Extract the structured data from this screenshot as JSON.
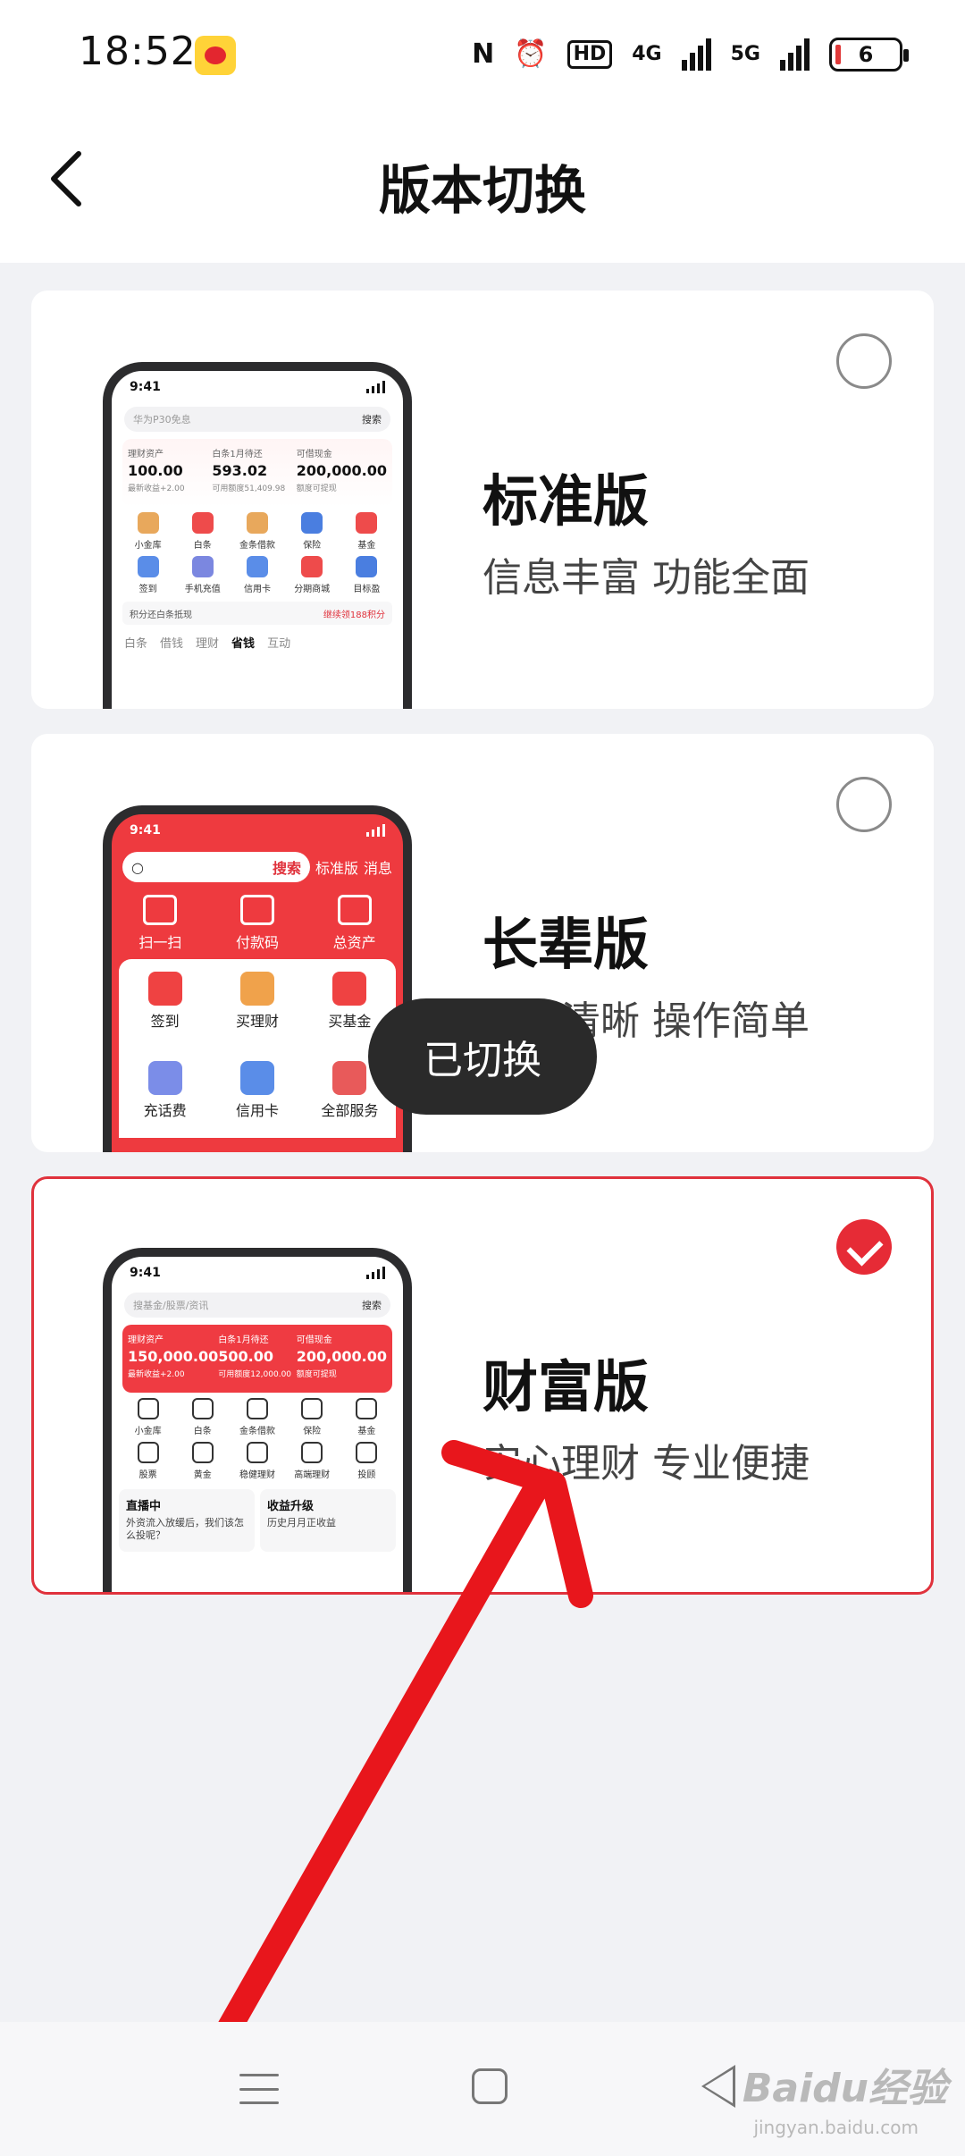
{
  "status_bar": {
    "time": "18:52",
    "hd_label": "HD",
    "net1": "4G",
    "net2": "5G",
    "battery": "6"
  },
  "header": {
    "title": "版本切换"
  },
  "cards": [
    {
      "title": "标准版",
      "desc": "信息丰富 功能全面",
      "selected": false,
      "phone": {
        "time": "9:41",
        "search_placeholder": "华为P30免息",
        "search_button": "搜索",
        "stats": [
          {
            "label": "理财资产",
            "value": "100.00",
            "sub": "最新收益+2.00"
          },
          {
            "label": "白条1月待还",
            "value": "593.02",
            "sub": "可用额度51,409.98"
          },
          {
            "label": "可借现金",
            "value": "200,000.00",
            "sub": "额度可提现"
          }
        ],
        "grid": [
          "小金库",
          "白条",
          "金条借款",
          "保险",
          "基金",
          "签到",
          "手机充值",
          "信用卡",
          "分期商城",
          "目标盈"
        ],
        "banner_left": "积分还白条抵现",
        "banner_right": "继续领188积分",
        "tabs": [
          "白条",
          "借钱",
          "理财",
          "省钱",
          "互动"
        ],
        "active_tab": "省钱"
      }
    },
    {
      "title": "长辈版",
      "desc": "大字清晰 操作简单",
      "selected": false,
      "phone": {
        "time": "9:41",
        "search_button": "搜索",
        "version_label": "标准版",
        "msg_label": "消息",
        "top": [
          "扫一扫",
          "付款码",
          "总资产"
        ],
        "grid": [
          "签到",
          "买理财",
          "买基金",
          "充话费",
          "信用卡",
          "全部服务"
        ]
      }
    },
    {
      "title": "财富版",
      "desc": "安心理财 专业便捷",
      "selected": true,
      "phone": {
        "time": "9:41",
        "search_placeholder": "搜基金/股票/资讯",
        "search_button": "搜索",
        "stats": [
          {
            "label": "理财资产",
            "value": "150,000.00",
            "sub": "最新收益+2.00"
          },
          {
            "label": "白条1月待还",
            "value": "500.00",
            "sub": "可用额度12,000.00"
          },
          {
            "label": "可借现金",
            "value": "200,000.00",
            "sub": "额度可提现"
          }
        ],
        "grid": [
          "小金库",
          "白条",
          "金条借款",
          "保险",
          "基金",
          "股票",
          "黄金",
          "稳健理财",
          "高端理财",
          "投顾"
        ],
        "live_title": "直播中",
        "live_text": "外资流入放缓后，我们该怎么投呢？",
        "upgrade_title": "收益升级",
        "upgrade_text": "历史月月正收益"
      }
    }
  ],
  "toast": "已切换",
  "watermark": "Baidu经验",
  "watermark_url": "jingyan.baidu.com",
  "colors": {
    "accent": "#e62b36",
    "background": "#f1f2f5"
  }
}
